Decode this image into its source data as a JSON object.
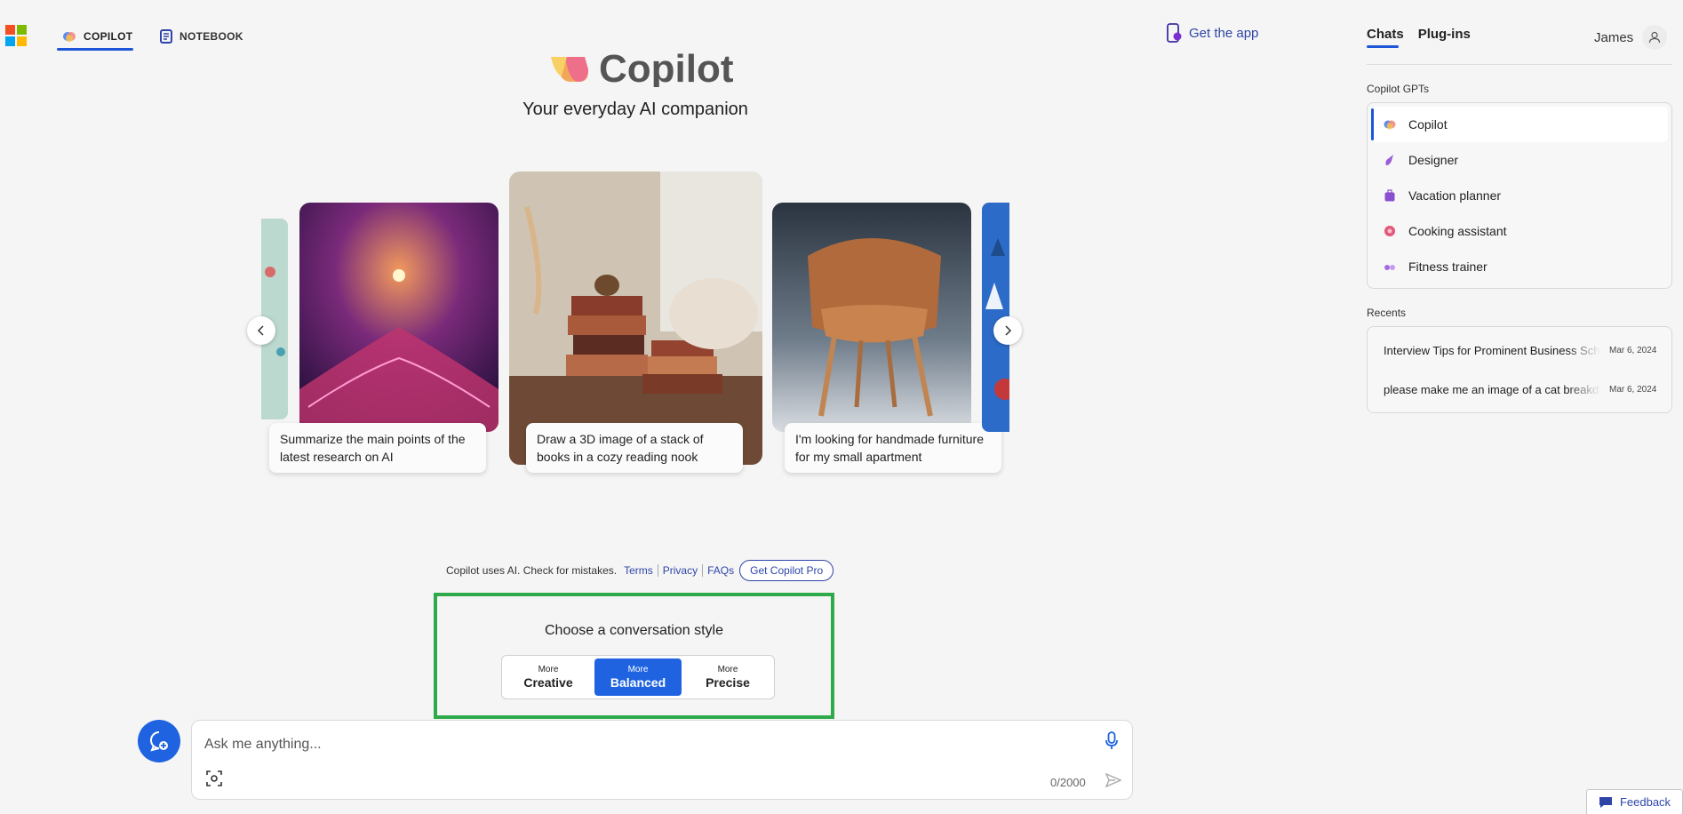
{
  "topbar": {
    "tabs": [
      {
        "label": "COPILOT",
        "active": true
      },
      {
        "label": "NOTEBOOK",
        "active": false
      }
    ],
    "get_app": "Get the app"
  },
  "hero": {
    "wordmark": "Copilot",
    "tagline": "Your everyday AI companion"
  },
  "carousel": {
    "cards": [
      {
        "caption": "Summarize the main points of the latest research on AI"
      },
      {
        "caption": "Draw a 3D image of a stack of books in a cozy reading nook"
      },
      {
        "caption": "I'm looking for handmade furniture for my small apartment"
      }
    ]
  },
  "disclaimer": {
    "text": "Copilot uses AI. Check for mistakes.",
    "links": [
      "Terms",
      "Privacy",
      "FAQs"
    ],
    "pro_button": "Get Copilot Pro"
  },
  "conversation_style": {
    "title": "Choose a conversation style",
    "options": [
      {
        "small": "More",
        "big": "Creative",
        "active": false
      },
      {
        "small": "More",
        "big": "Balanced",
        "active": true
      },
      {
        "small": "More",
        "big": "Precise",
        "active": false
      }
    ]
  },
  "composer": {
    "placeholder": "Ask me anything...",
    "counter": "0/2000"
  },
  "right_panel": {
    "tabs": [
      "Chats",
      "Plug-ins"
    ],
    "user_name": "James",
    "gpts_label": "Copilot GPTs",
    "gpts": [
      {
        "label": "Copilot",
        "icon": "copilot-icon",
        "color": "#5b8def"
      },
      {
        "label": "Designer",
        "icon": "designer-icon",
        "color": "#9a5fd6"
      },
      {
        "label": "Vacation planner",
        "icon": "suitcase-icon",
        "color": "#8a4fd0"
      },
      {
        "label": "Cooking assistant",
        "icon": "cooking-icon",
        "color": "#e4577a"
      },
      {
        "label": "Fitness trainer",
        "icon": "dumbbell-icon",
        "color": "#a46be0"
      }
    ],
    "recents_label": "Recents",
    "recents": [
      {
        "title": "Interview Tips for Prominent Business School",
        "date": "Mar 6, 2024"
      },
      {
        "title": "please make me an image of a cat breakdancing",
        "date": "Mar 6, 2024"
      }
    ]
  },
  "feedback": "Feedback",
  "colors": {
    "accent": "#1f63e0",
    "link": "#2e45a8",
    "highlight_box": "#2eaa4a"
  }
}
